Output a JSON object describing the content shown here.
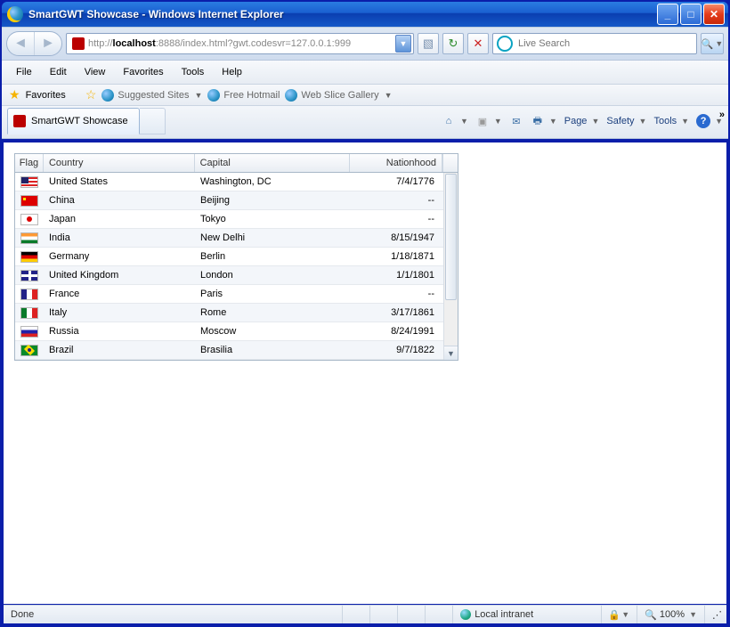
{
  "window": {
    "title": "SmartGWT Showcase - Windows Internet Explorer"
  },
  "url": {
    "grey_prefix": "http://",
    "host": "localhost",
    "grey_suffix": ":8888/index.html?gwt.codesvr=127.0.0.1:999"
  },
  "search": {
    "placeholder": "Live Search"
  },
  "menu": {
    "file": "File",
    "edit": "Edit",
    "view": "View",
    "favorites": "Favorites",
    "tools": "Tools",
    "help": "Help"
  },
  "favbar": {
    "favorites": "Favorites",
    "suggested": "Suggested Sites",
    "hotmail": "Free Hotmail",
    "webslice": "Web Slice Gallery"
  },
  "tabs": {
    "active": "SmartGWT Showcase"
  },
  "cmd": {
    "page": "Page",
    "safety": "Safety",
    "tools": "Tools"
  },
  "grid": {
    "headers": {
      "flag": "Flag",
      "country": "Country",
      "capital": "Capital",
      "nationhood": "Nationhood"
    },
    "rows": [
      {
        "flag": "us",
        "country": "United States",
        "capital": "Washington, DC",
        "nationhood": "7/4/1776"
      },
      {
        "flag": "cn",
        "country": "China",
        "capital": "Beijing",
        "nationhood": "--"
      },
      {
        "flag": "jp",
        "country": "Japan",
        "capital": "Tokyo",
        "nationhood": "--"
      },
      {
        "flag": "in",
        "country": "India",
        "capital": "New Delhi",
        "nationhood": "8/15/1947"
      },
      {
        "flag": "de",
        "country": "Germany",
        "capital": "Berlin",
        "nationhood": "1/18/1871"
      },
      {
        "flag": "uk",
        "country": "United Kingdom",
        "capital": "London",
        "nationhood": "1/1/1801"
      },
      {
        "flag": "fr",
        "country": "France",
        "capital": "Paris",
        "nationhood": "--"
      },
      {
        "flag": "it",
        "country": "Italy",
        "capital": "Rome",
        "nationhood": "3/17/1861"
      },
      {
        "flag": "ru",
        "country": "Russia",
        "capital": "Moscow",
        "nationhood": "8/24/1991"
      },
      {
        "flag": "br",
        "country": "Brazil",
        "capital": "Brasilia",
        "nationhood": "9/7/1822"
      }
    ]
  },
  "status": {
    "done": "Done",
    "zone": "Local intranet",
    "zoom": "100%"
  }
}
